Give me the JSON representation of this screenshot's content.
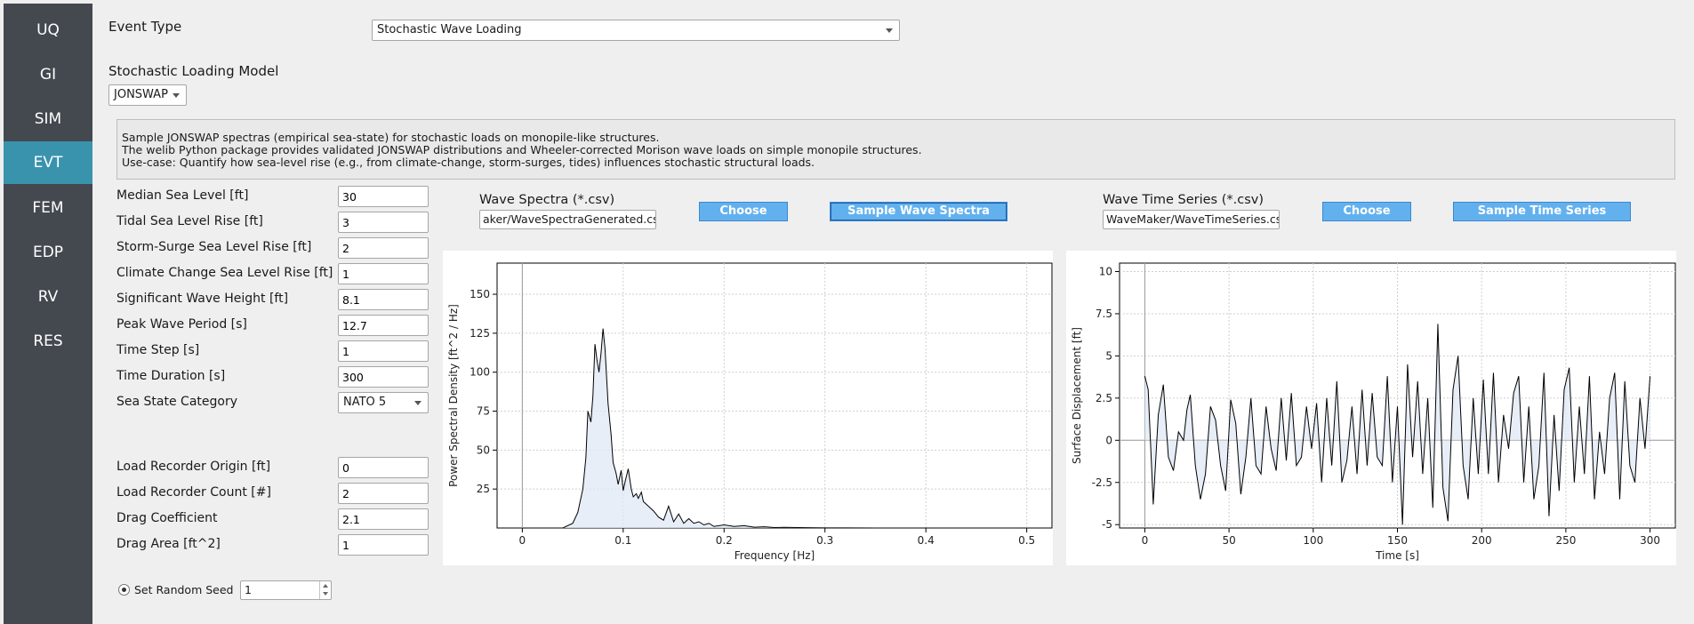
{
  "sidebar": {
    "items": [
      {
        "label": "UQ",
        "active": false
      },
      {
        "label": "GI",
        "active": false
      },
      {
        "label": "SIM",
        "active": false
      },
      {
        "label": "EVT",
        "active": true
      },
      {
        "label": "FEM",
        "active": false
      },
      {
        "label": "EDP",
        "active": false
      },
      {
        "label": "RV",
        "active": false
      },
      {
        "label": "RES",
        "active": false
      }
    ],
    "active_color": "#3a93ad",
    "background_color": "#444950"
  },
  "event_type": {
    "label": "Event Type",
    "value": "Stochastic Wave Loading"
  },
  "loading_model": {
    "label": "Stochastic Loading Model",
    "value": "JONSWAP"
  },
  "description": [
    "Sample JONSWAP spectras (empirical sea-state) for stochastic loads on monopile-like structures.",
    "The welib Python package provides validated JONSWAP distributions and Wheeler-corrected Morison wave loads on simple monopile structures.",
    "Use-case: Quantify how sea-level rise (e.g., from climate-change, storm-surges, tides) influences stochastic structural loads."
  ],
  "params": [
    {
      "label": "Median Sea Level [ft]",
      "value": "30"
    },
    {
      "label": "Tidal Sea Level Rise [ft]",
      "value": "3"
    },
    {
      "label": "Storm-Surge Sea Level Rise [ft]",
      "value": "2"
    },
    {
      "label": "Climate Change Sea Level Rise [ft]",
      "value": "1"
    },
    {
      "label": "Significant Wave Height [ft]",
      "value": "8.1"
    },
    {
      "label": "Peak Wave Period [s]",
      "value": "12.7"
    },
    {
      "label": "Time Step [s]",
      "value": "1"
    },
    {
      "label": "Time Duration [s]",
      "value": "300"
    }
  ],
  "sea_state": {
    "label": "Sea State Category",
    "value": "NATO 5"
  },
  "load_params": [
    {
      "label": "Load Recorder Origin [ft]",
      "value": "0"
    },
    {
      "label": "Load Recorder Count [#]",
      "value": "2"
    },
    {
      "label": "Drag Coefficient",
      "value": "2.1"
    },
    {
      "label": "Drag Area [ft^2]",
      "value": "1"
    }
  ],
  "random_seed": {
    "label": "Set Random Seed",
    "value": "1",
    "checked": true
  },
  "wave_spectra": {
    "label": "Wave Spectra (*.csv)",
    "path": "aker/WaveSpectraGenerated.csv",
    "choose_label": "Choose",
    "sample_label": "Sample Wave Spectra"
  },
  "wave_time_series": {
    "label": "Wave Time Series (*.csv)",
    "path": "WaveMaker/WaveTimeSeries.csv",
    "choose_label": "Choose",
    "sample_label": "Sample Time Series"
  },
  "button_color": "#62b1ee",
  "chart_data": [
    {
      "type": "area",
      "xlabel": "Frequency [Hz]",
      "ylabel": "Power Spectral Density [ft^2 / Hz]",
      "xlim": [
        -0.025,
        0.525
      ],
      "ylim": [
        0,
        170
      ],
      "xticks": [
        "0",
        "0.1",
        "0.2",
        "0.3",
        "0.4",
        "0.5"
      ],
      "yticks": [
        "25",
        "50",
        "75",
        "100",
        "125",
        "150"
      ],
      "grid": true,
      "x": [
        0.04,
        0.05,
        0.055,
        0.06,
        0.063,
        0.065,
        0.068,
        0.07,
        0.072,
        0.074,
        0.076,
        0.078,
        0.08,
        0.082,
        0.085,
        0.088,
        0.09,
        0.093,
        0.095,
        0.098,
        0.1,
        0.102,
        0.105,
        0.108,
        0.11,
        0.113,
        0.115,
        0.118,
        0.12,
        0.125,
        0.13,
        0.135,
        0.14,
        0.145,
        0.15,
        0.155,
        0.16,
        0.165,
        0.17,
        0.175,
        0.18,
        0.185,
        0.19,
        0.2,
        0.21,
        0.22,
        0.23,
        0.24,
        0.25,
        0.26,
        0.28,
        0.3,
        0.32,
        0.35,
        0.4,
        0.45,
        0.5
      ],
      "y": [
        0,
        3,
        10,
        25,
        45,
        75,
        68,
        85,
        118,
        108,
        100,
        112,
        128,
        115,
        80,
        60,
        42,
        35,
        28,
        37,
        24,
        30,
        38,
        25,
        20,
        22,
        19,
        23,
        17,
        14,
        11,
        7,
        5,
        14,
        4,
        9,
        3,
        6,
        3,
        4,
        2,
        3,
        1,
        2,
        1,
        1.5,
        0.5,
        0.8,
        0.3,
        0.4,
        0.2,
        0.1,
        0.1,
        0,
        0,
        0,
        0
      ]
    },
    {
      "type": "line",
      "xlabel": "Time [s]",
      "ylabel": "Surface Displacement [ft]",
      "xlim": [
        -15,
        315
      ],
      "ylim": [
        -5.2,
        10.5
      ],
      "xticks": [
        "0",
        "50",
        "100",
        "150",
        "200",
        "250",
        "300"
      ],
      "yticks": [
        "10",
        "7.5",
        "5",
        "2.5",
        "0",
        "-2.5",
        "-5"
      ],
      "grid": true,
      "x": [
        0,
        2,
        5,
        8,
        11,
        14,
        17,
        20,
        23,
        25,
        27,
        30,
        33,
        36,
        39,
        42,
        45,
        48,
        51,
        54,
        57,
        60,
        63,
        66,
        69,
        72,
        75,
        78,
        81,
        84,
        87,
        90,
        93,
        96,
        99,
        102,
        105,
        108,
        111,
        114,
        117,
        120,
        123,
        126,
        129,
        132,
        135,
        138,
        141,
        144,
        147,
        150,
        153,
        156,
        159,
        162,
        165,
        168,
        171,
        174,
        177,
        180,
        183,
        186,
        189,
        192,
        195,
        198,
        201,
        204,
        207,
        210,
        213,
        216,
        219,
        222,
        225,
        228,
        231,
        234,
        237,
        240,
        243,
        246,
        249,
        252,
        255,
        258,
        261,
        264,
        267,
        270,
        273,
        276,
        279,
        282,
        285,
        288,
        291,
        294,
        297,
        300
      ],
      "y": [
        3.8,
        3.0,
        -3.8,
        1.5,
        3.3,
        -1.0,
        -1.8,
        0.5,
        0.0,
        1.8,
        2.7,
        -1.5,
        -3.5,
        -2.0,
        2.0,
        1.2,
        -1.5,
        -3.0,
        2.4,
        1.0,
        -3.2,
        -1.0,
        2.5,
        -1.5,
        -2.0,
        2.0,
        -0.5,
        -1.8,
        2.5,
        -1.2,
        2.8,
        -1.5,
        -1.0,
        2.0,
        -0.5,
        2.2,
        -2.5,
        2.5,
        -1.5,
        3.5,
        -2.5,
        -1.2,
        2.0,
        -2.0,
        3.0,
        -1.5,
        2.8,
        -1.0,
        -1.5,
        3.8,
        -2.5,
        2.0,
        -5.0,
        4.5,
        -1.0,
        3.5,
        -2.0,
        2.5,
        -4.0,
        6.9,
        -2.8,
        -4.8,
        3.0,
        5.0,
        -1.5,
        -3.5,
        2.5,
        -2.0,
        3.6,
        -2.0,
        4.0,
        -2.5,
        1.5,
        -0.5,
        2.8,
        3.8,
        -2.5,
        2.0,
        -3.5,
        -1.5,
        4.0,
        -4.5,
        1.5,
        -3.0,
        3.0,
        4.3,
        -2.5,
        2.0,
        -2.0,
        3.8,
        -3.5,
        0.5,
        -2.0,
        2.5,
        4.0,
        -3.5,
        3.5,
        -1.5,
        -2.5,
        2.5,
        -0.5,
        3.8
      ]
    }
  ]
}
